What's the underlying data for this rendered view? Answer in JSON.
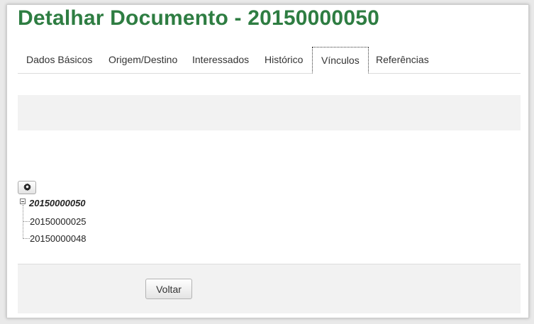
{
  "page": {
    "title": "Detalhar Documento - 20150000050"
  },
  "tabs": [
    {
      "label": "Dados Básicos",
      "active": false
    },
    {
      "label": "Origem/Destino",
      "active": false
    },
    {
      "label": "Interessados",
      "active": false
    },
    {
      "label": "Histórico",
      "active": false
    },
    {
      "label": "Vínculos",
      "active": true
    },
    {
      "label": "Referências",
      "active": false
    }
  ],
  "toolbar": {
    "settings_icon": "gear-icon"
  },
  "tree": {
    "root": {
      "label": "20150000050",
      "expanded": true
    },
    "children": [
      {
        "label": "20150000025"
      },
      {
        "label": "20150000048"
      }
    ]
  },
  "footer": {
    "back_label": "Voltar"
  },
  "colors": {
    "title": "#2e7d42",
    "panel_gray": "#f2f2f2"
  }
}
